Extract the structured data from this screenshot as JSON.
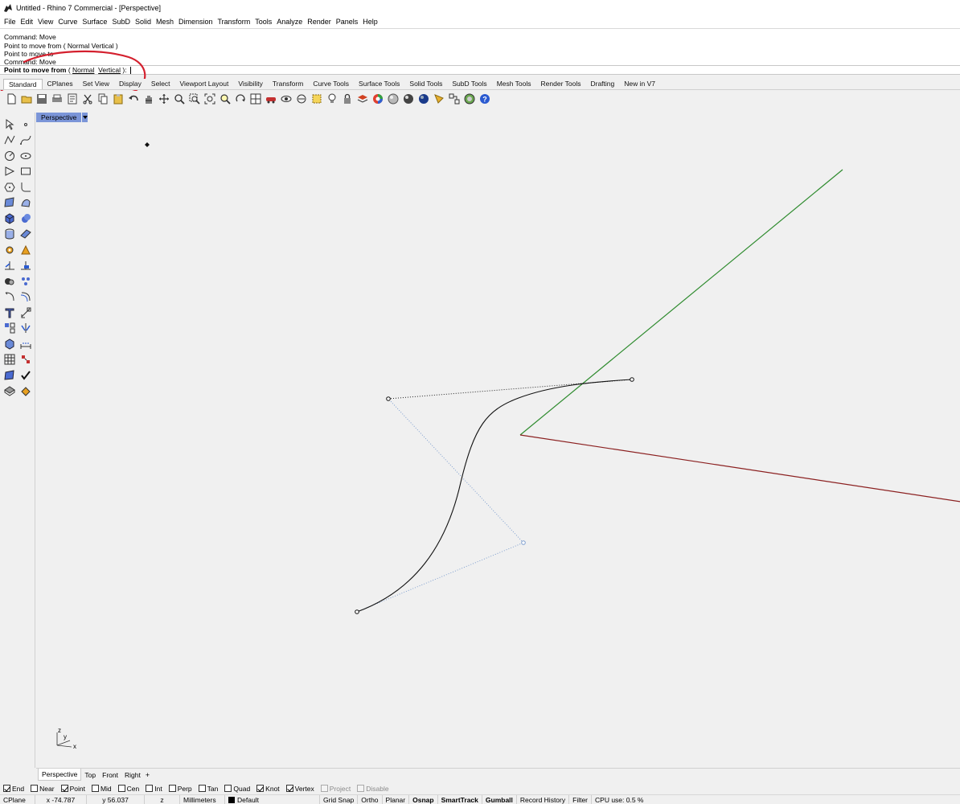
{
  "window": {
    "title": "Untitled - Rhino 7 Commercial - [Perspective]"
  },
  "menu": [
    "File",
    "Edit",
    "View",
    "Curve",
    "Surface",
    "SubD",
    "Solid",
    "Mesh",
    "Dimension",
    "Transform",
    "Tools",
    "Analyze",
    "Render",
    "Panels",
    "Help"
  ],
  "command_history": {
    "lines": [
      "Command: Move",
      "Point to move from ( Normal  Vertical )",
      "Point to move to",
      "Command: Move"
    ]
  },
  "command_prompt": {
    "prompt": "Point to move from",
    "open": " ( ",
    "opt1": "Normal",
    "opt2": "Vertical",
    "close": " ): "
  },
  "toolbar_tabs": [
    "Standard",
    "CPlanes",
    "Set View",
    "Display",
    "Select",
    "Viewport Layout",
    "Visibility",
    "Transform",
    "Curve Tools",
    "Surface Tools",
    "Solid Tools",
    "SubD Tools",
    "Mesh Tools",
    "Render Tools",
    "Drafting",
    "New in V7"
  ],
  "viewport": {
    "name": "Perspective",
    "axis_labels": {
      "z": "z",
      "y": "y",
      "x": "x"
    }
  },
  "viewport_tabs": [
    "Perspective",
    "Top",
    "Front",
    "Right",
    "+"
  ],
  "osnaps": [
    {
      "label": "End",
      "checked": true
    },
    {
      "label": "Near",
      "checked": false
    },
    {
      "label": "Point",
      "checked": true
    },
    {
      "label": "Mid",
      "checked": false
    },
    {
      "label": "Cen",
      "checked": false
    },
    {
      "label": "Int",
      "checked": false
    },
    {
      "label": "Perp",
      "checked": false
    },
    {
      "label": "Tan",
      "checked": false
    },
    {
      "label": "Quad",
      "checked": false
    },
    {
      "label": "Knot",
      "checked": true
    },
    {
      "label": "Vertex",
      "checked": true
    },
    {
      "label": "Project",
      "checked": false,
      "disabled": true
    },
    {
      "label": "Disable",
      "checked": false,
      "disabled": true
    }
  ],
  "status": {
    "cplane": "CPlane",
    "x": "x -74.787",
    "y": "y 56.037",
    "z": "z",
    "units": "Millimeters",
    "layer": "Default",
    "grid_snap": "Grid Snap",
    "ortho": "Ortho",
    "planar": "Planar",
    "osnap": "Osnap",
    "smarttrack": "SmartTrack",
    "gumball": "Gumball",
    "record_history": "Record History",
    "filter": "Filter",
    "cpu": "CPU use: 0.5 %"
  },
  "colors": {
    "y_axis": "#2e8b2e",
    "x_axis": "#8b2020",
    "annotation": "#d4202e",
    "viewport_title": "#7b95d8",
    "control_polygon": "#7f9fcf"
  }
}
